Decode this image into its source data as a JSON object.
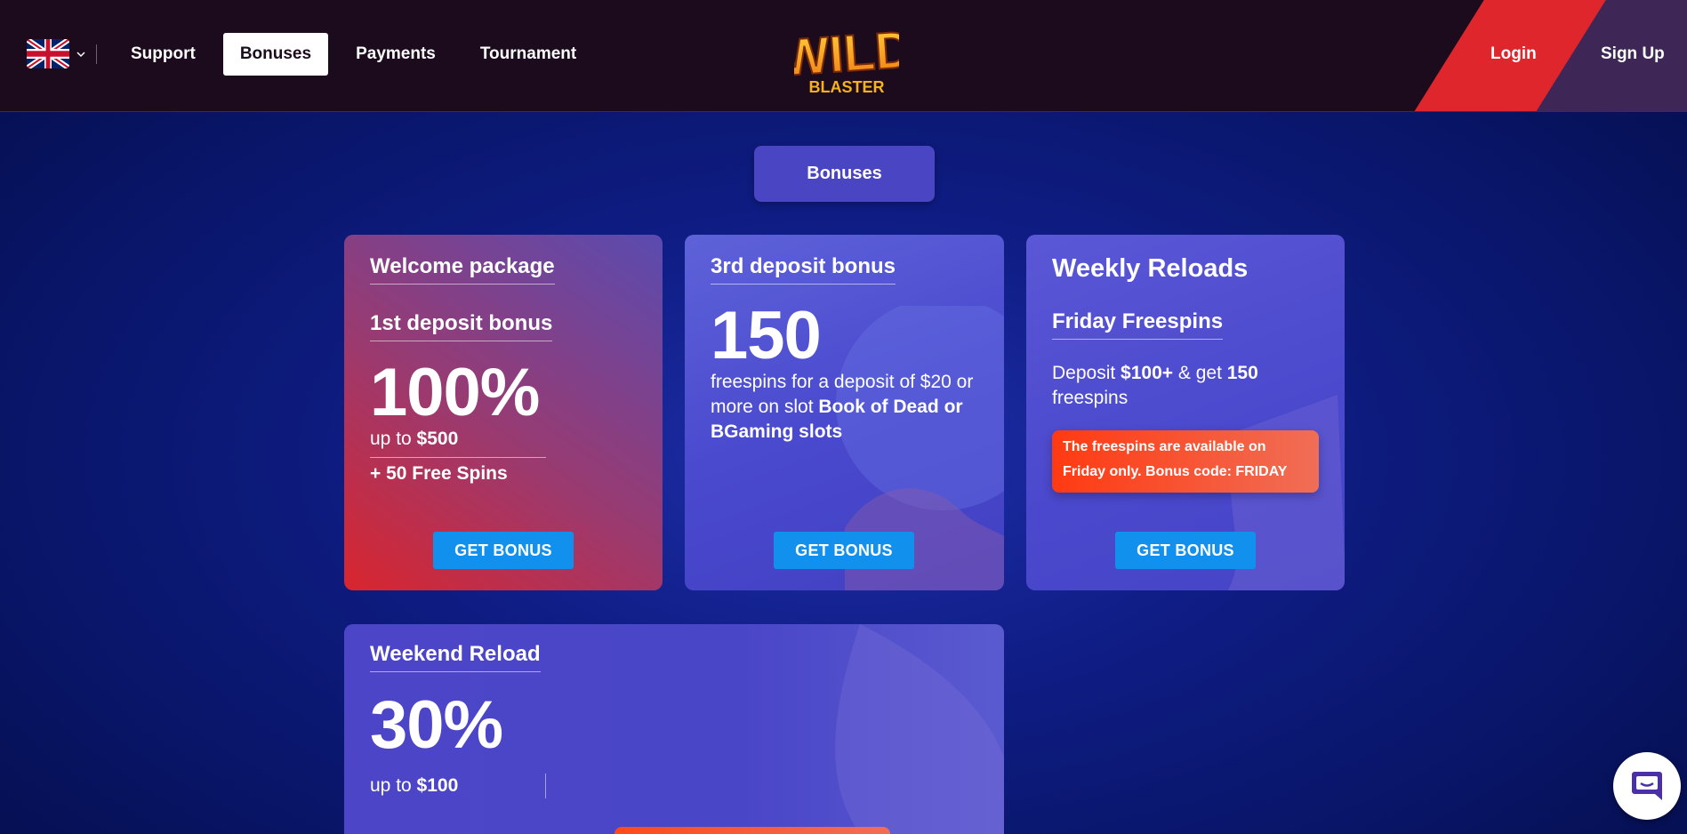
{
  "header": {
    "language_icon": "uk-flag-icon",
    "nav": [
      "Support",
      "Bonuses",
      "Payments",
      "Tournament"
    ],
    "active_nav": "Bonuses",
    "logo_text": [
      "WILD",
      "BLASTER"
    ],
    "login_label": "Login",
    "signup_label": "Sign Up",
    "colors": {
      "bg": "#1b0b1d",
      "login": "#e0262d",
      "signup": "#3e2756"
    }
  },
  "page_title": "Bonuses",
  "cards": {
    "welcome": {
      "title": "Welcome package",
      "subtitle": "1st deposit bonus",
      "big": "100%",
      "upto_prefix": "up to ",
      "upto_value": "$500",
      "extra": "+ 50 Free Spins",
      "button": "GET BONUS"
    },
    "third": {
      "title": "3rd deposit bonus",
      "big": "150",
      "text_plain": "freespins for a deposit of $20 or more on slot ",
      "text_bold": "Book of Dead or BGaming slots",
      "button": "GET BONUS"
    },
    "weekly": {
      "title": "Weekly Reloads",
      "subtitle": "Friday Freespins",
      "t1": "Deposit ",
      "t2": "$100+",
      "t3": " & get ",
      "t4": "150",
      "t5": " freespins",
      "notice": "The freespins are available on Friday only. Bonus code: FRIDAY",
      "button": "GET BONUS"
    },
    "weekend": {
      "title": "Weekend Reload",
      "big": "30%",
      "upto_prefix": "up to ",
      "upto_value": "$100"
    }
  },
  "chat_icon": "chat-bubble-icon",
  "accent_color": "#1290ee"
}
